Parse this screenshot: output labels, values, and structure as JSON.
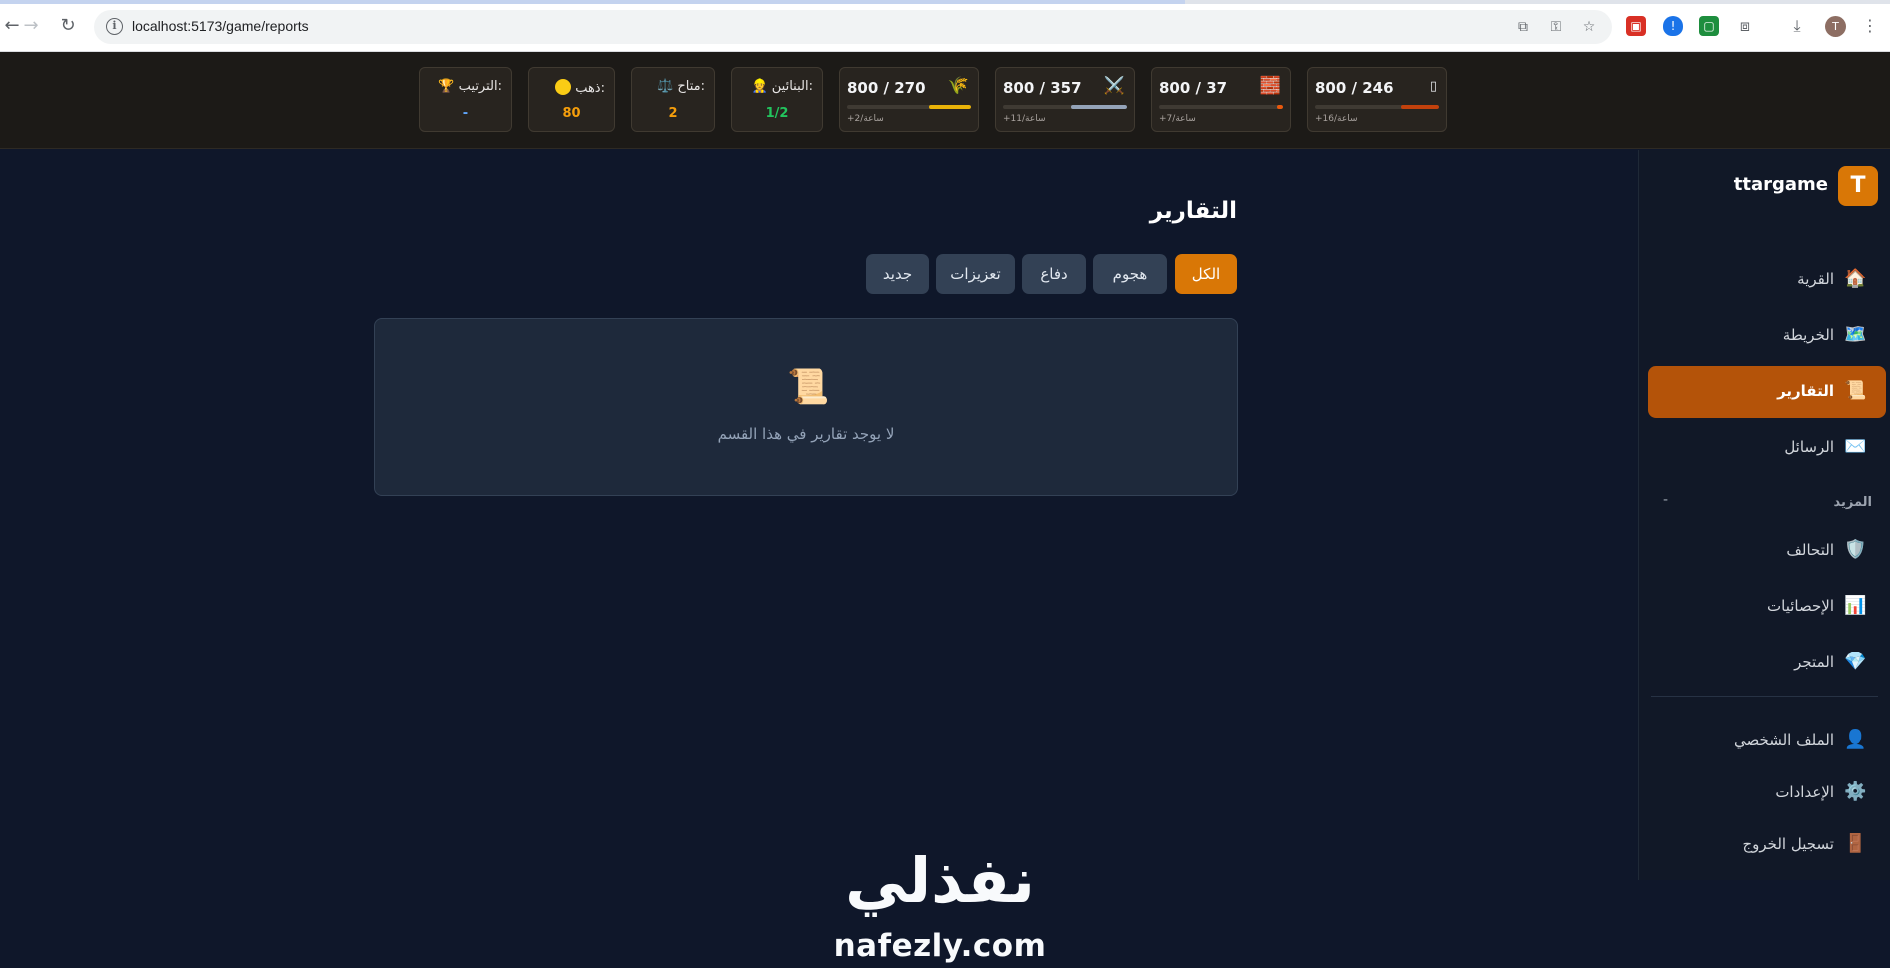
{
  "browser": {
    "url": "localhost:5173/game/reports",
    "avatar_initial": "T"
  },
  "resources": [
    {
      "id": "r1",
      "amount": "800 / 246",
      "rate": "+16/ساعة",
      "icon": "resource-icon",
      "glyph": "▯",
      "level": 0.31,
      "color": "#c2410c"
    },
    {
      "id": "r2",
      "amount": "800 / 37",
      "rate": "+7/ساعة",
      "icon": "brick-icon",
      "glyph": "🧱",
      "level": 0.05,
      "color": "#ea580c"
    },
    {
      "id": "r3",
      "amount": "800 / 357",
      "rate": "+11/ساعة",
      "icon": "crossed-swords-icon",
      "glyph": "⚔️",
      "level": 0.45,
      "color": "#94a3b8"
    },
    {
      "id": "r4",
      "amount": "800 / 270",
      "rate": "+2/ساعة",
      "icon": "wheat-icon",
      "glyph": "🌾",
      "level": 0.34,
      "color": "#eab308"
    }
  ],
  "stats": {
    "builders": {
      "label": "البنائين:",
      "value": "1/2",
      "icon": "builder-icon",
      "glyph": "👷",
      "color": "#22c55e"
    },
    "available": {
      "label": "متاح:",
      "value": "2",
      "icon": "scales-icon",
      "glyph": "⚖️",
      "color": "#f59e0b"
    },
    "gold": {
      "label": "ذهب:",
      "value": "80",
      "icon": "gold-coin-icon",
      "glyph": "🟡",
      "color": "#f59e0b"
    },
    "rank": {
      "label": "الترتيب:",
      "value": "-",
      "icon": "trophy-icon",
      "glyph": "🏆",
      "color": "#60a5fa"
    }
  },
  "page": {
    "title": "التقارير",
    "filters": [
      "الكل",
      "هجوم",
      "دفاع",
      "تعزيزات",
      "جديد"
    ],
    "active_filter": 0,
    "empty_icon": "scroll-icon",
    "empty_glyph": "📜",
    "empty_text": "لا يوجد تقارير في هذا القسم"
  },
  "sidebar": {
    "logo_letter": "T",
    "brand": "ttargame",
    "items": [
      {
        "label": "القرية",
        "icon": "house-icon",
        "glyph": "🏠"
      },
      {
        "label": "الخريطة",
        "icon": "map-icon",
        "glyph": "🗺️"
      },
      {
        "label": "التقارير",
        "icon": "scroll-icon",
        "glyph": "📜",
        "active": true
      },
      {
        "label": "الرسائل",
        "icon": "envelope-icon",
        "glyph": "✉️"
      }
    ],
    "more_label": "المزيد",
    "more_toggle": "-",
    "more_items": [
      {
        "label": "التحالف",
        "icon": "shield-icon",
        "glyph": "🛡️"
      },
      {
        "label": "الإحصائيات",
        "icon": "bar-chart-icon",
        "glyph": "📊"
      },
      {
        "label": "المتجر",
        "icon": "gem-icon",
        "glyph": "💎"
      }
    ],
    "account_items": [
      {
        "label": "الملف الشخصي",
        "icon": "user-icon",
        "glyph": "👤"
      },
      {
        "label": "الإعدادات",
        "icon": "gear-icon",
        "glyph": "⚙️"
      },
      {
        "label": "تسجيل الخروج",
        "icon": "door-icon",
        "glyph": "🚪"
      }
    ]
  },
  "watermark": {
    "arabic": "نفذلي",
    "latin": "nafezly.com"
  }
}
